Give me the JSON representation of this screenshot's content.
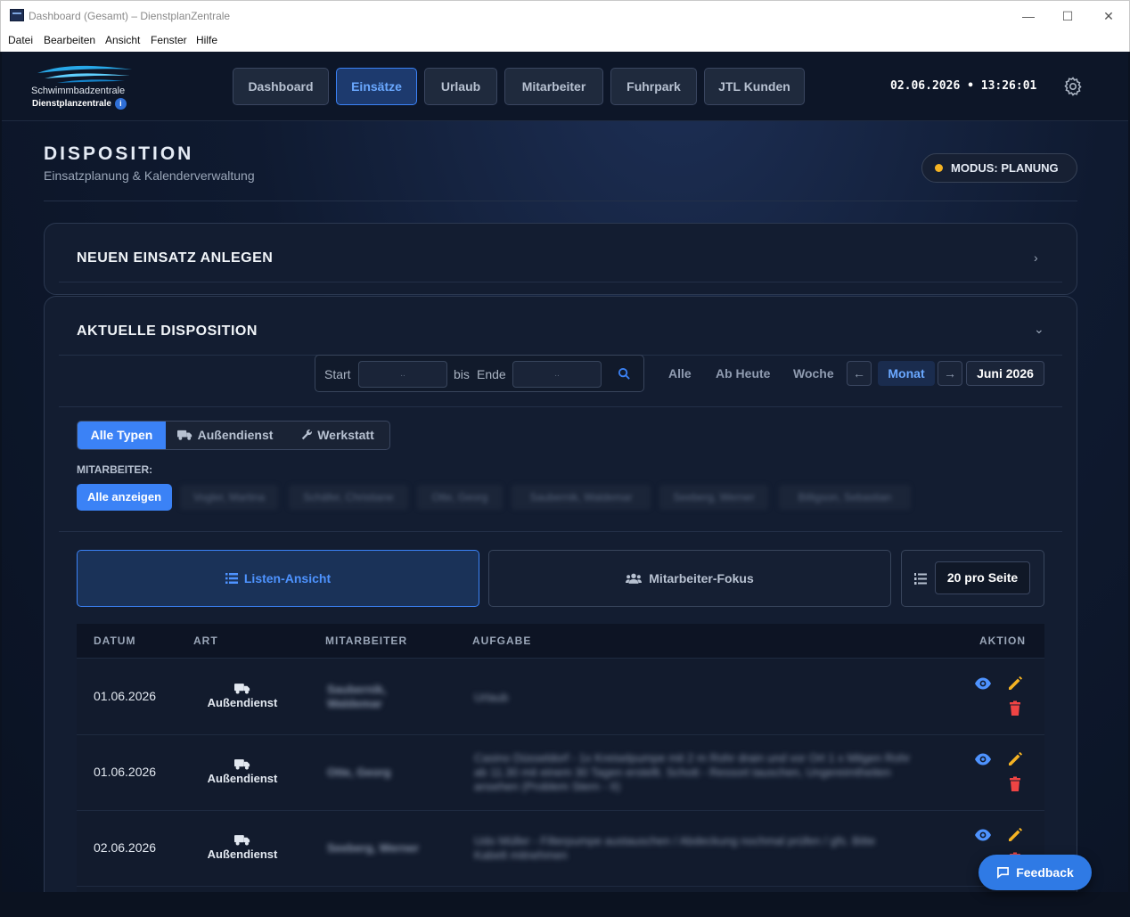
{
  "window": {
    "title": "Dashboard (Gesamt) – DienstplanZentrale"
  },
  "menu": [
    "Datei",
    "Bearbeiten",
    "Ansicht",
    "Fenster",
    "Hilfe"
  ],
  "logo": {
    "line1": "Schwimmbadzentrale",
    "line2": "Dienstplanzentrale",
    "info": "i"
  },
  "nav": {
    "tabs": [
      "Dashboard",
      "Einsätze",
      "Urlaub",
      "Mitarbeiter",
      "Fuhrpark",
      "JTL Kunden"
    ],
    "active": "Einsätze"
  },
  "clock": "02.06.2026 • 13:26:01",
  "header": {
    "title": "DISPOSITION",
    "subtitle": "Einsatzplanung & Kalenderverwaltung",
    "mode": "MODUS: PLANUNG"
  },
  "sections": {
    "new": "NEUEN EINSATZ ANLEGEN",
    "current": "AKTUELLE DISPOSITION"
  },
  "filter": {
    "start_label": "Start",
    "start_value": "..",
    "bis": "bis",
    "end_label": "Ende",
    "end_value": "..",
    "quick": [
      "Alle",
      "Ab Heute",
      "Woche"
    ],
    "prev": "←",
    "period": "Monat",
    "next": "→",
    "current_period": "Juni 2026"
  },
  "types": {
    "all": "Alle Typen",
    "aussendienst": "Außendienst",
    "werkstatt": "Werkstatt"
  },
  "employees": {
    "label": "MITARBEITER:",
    "all": "Alle anzeigen",
    "pills": [
      "Vogler, Martina",
      "Schäfer, Christiane",
      "Otte, Georg",
      "Saubernik, Waldemar",
      "Seeberg, Werner",
      "Billigson, Sebastian"
    ]
  },
  "views": {
    "list": "Listen-Ansicht",
    "focus": "Mitarbeiter-Fokus",
    "per_page": "20 pro Seite"
  },
  "table": {
    "headers": {
      "datum": "DATUM",
      "art": "ART",
      "mitarbeiter": "MITARBEITER",
      "aufgabe": "AUFGABE",
      "aktion": "AKTION"
    },
    "rows": [
      {
        "datum": "01.06.2026",
        "art": "Außendienst",
        "mitarbeiter": "Saubernik, Waldemar",
        "aufgabe": "Urlaub"
      },
      {
        "datum": "01.06.2026",
        "art": "Außendienst",
        "mitarbeiter": "Otte, Georg",
        "aufgabe": "Casino Düsseldorf - 1x Kreiselpumpe mit 2 m Rohr drain und vor Ort 1 x Mitgen Rohr ab 11.30 mit einem 30 Tagen erstellt. Schott - Ressort tauschen, Ungereimtheiten ansehen (Problem Stern - II)"
      },
      {
        "datum": "02.06.2026",
        "art": "Außendienst",
        "mitarbeiter": "Seeberg, Werner",
        "aufgabe": "Udo Müller - Filterpumpe austauschen / Abdeckung nochmal prüfen / gfs. Bitte Kabelt mitnehmen"
      }
    ]
  },
  "feedback": "Feedback",
  "colors": {
    "accent": "#3b82f6",
    "mode_dot": "#f5b323",
    "edit": "#f5b323",
    "delete": "#ef4444",
    "view": "#4e93ff"
  }
}
